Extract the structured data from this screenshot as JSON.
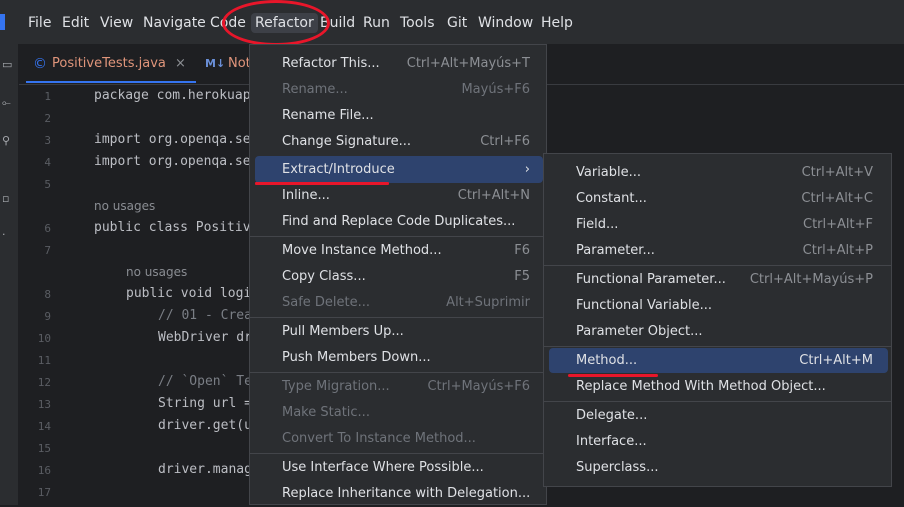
{
  "menubar": {
    "items": [
      "File",
      "Edit",
      "View",
      "Navigate",
      "Code",
      "Refactor",
      "Build",
      "Run",
      "Tools",
      "Git",
      "Window",
      "Help"
    ]
  },
  "tabs": [
    {
      "label": "PositiveTests.java"
    },
    {
      "label": "Not"
    }
  ],
  "tab_close": "×",
  "tab_md_icon": "M↓",
  "editor": {
    "line_numbers": [
      "1",
      "2",
      "3",
      "4",
      "5",
      "6",
      "7",
      "8",
      "9",
      "10",
      "11",
      "12",
      "13",
      "14",
      "15",
      "16",
      "17"
    ],
    "lines": {
      "l1": "package com.herokuap",
      "l3": "import org.openqa.se",
      "l4": "import org.openqa.se",
      "hint1": "no usages",
      "l6": "public class Positiv",
      "hint2": "no usages",
      "l8": "public void logi",
      "l9": "// 01 - Crea",
      "l10": "WebDriver dr",
      "l12": "// `Open` Te",
      "l13": "String url =",
      "l14": "driver.get(u",
      "l16": "driver.manag"
    }
  },
  "refactor_menu": {
    "items": [
      {
        "label": "Refactor This...",
        "shortcut": "Ctrl+Alt+Mayús+T",
        "disabled": false
      },
      {
        "label": "Rename...",
        "shortcut": "Mayús+F6",
        "disabled": true
      },
      {
        "label": "Rename File...",
        "shortcut": "",
        "disabled": false
      },
      {
        "label": "Change Signature...",
        "shortcut": "Ctrl+F6",
        "disabled": false
      },
      {
        "label": "Extract/Introduce",
        "shortcut": "›",
        "disabled": false
      },
      {
        "label": "Inline...",
        "shortcut": "Ctrl+Alt+N",
        "disabled": false
      },
      {
        "label": "Find and Replace Code Duplicates...",
        "shortcut": "",
        "disabled": false
      },
      {
        "label": "Move Instance Method...",
        "shortcut": "F6",
        "disabled": false
      },
      {
        "label": "Copy Class...",
        "shortcut": "F5",
        "disabled": false
      },
      {
        "label": "Safe Delete...",
        "shortcut": "Alt+Suprimir",
        "disabled": true
      },
      {
        "label": "Pull Members Up...",
        "shortcut": "",
        "disabled": false
      },
      {
        "label": "Push Members Down...",
        "shortcut": "",
        "disabled": false
      },
      {
        "label": "Type Migration...",
        "shortcut": "Ctrl+Mayús+F6",
        "disabled": true
      },
      {
        "label": "Make Static...",
        "shortcut": "",
        "disabled": true
      },
      {
        "label": "Convert To Instance Method...",
        "shortcut": "",
        "disabled": true
      },
      {
        "label": "Use Interface Where Possible...",
        "shortcut": "",
        "disabled": false
      },
      {
        "label": "Replace Inheritance with Delegation...",
        "shortcut": "",
        "disabled": false
      }
    ]
  },
  "extract_submenu": {
    "items": [
      {
        "label": "Variable...",
        "shortcut": "Ctrl+Alt+V"
      },
      {
        "label": "Constant...",
        "shortcut": "Ctrl+Alt+C"
      },
      {
        "label": "Field...",
        "shortcut": "Ctrl+Alt+F"
      },
      {
        "label": "Parameter...",
        "shortcut": "Ctrl+Alt+P"
      },
      {
        "label": "Functional Parameter...",
        "shortcut": "Ctrl+Alt+Mayús+P"
      },
      {
        "label": "Functional Variable...",
        "shortcut": ""
      },
      {
        "label": "Parameter Object...",
        "shortcut": ""
      },
      {
        "label": "Method...",
        "shortcut": "Ctrl+Alt+M"
      },
      {
        "label": "Replace Method With Method Object...",
        "shortcut": ""
      },
      {
        "label": "Delegate...",
        "shortcut": ""
      },
      {
        "label": "Interface...",
        "shortcut": ""
      },
      {
        "label": "Superclass...",
        "shortcut": ""
      }
    ]
  },
  "colors": {
    "accent": "#3574f0",
    "selection": "#2e436e",
    "annotation_red": "#e8162a"
  }
}
